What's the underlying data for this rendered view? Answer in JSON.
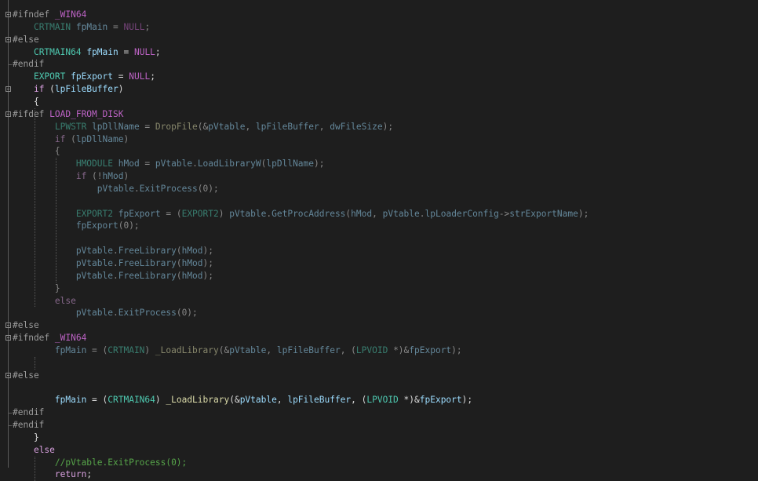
{
  "editor": {
    "lines": [
      {
        "fold": true,
        "dim": false,
        "tokens": [
          [
            "pre",
            "#ifndef "
          ],
          [
            "mac",
            "_WIN64"
          ]
        ]
      },
      {
        "fold": false,
        "dim": true,
        "tokens": [
          [
            "txt",
            "    "
          ],
          [
            "typ",
            "CRTMAIN"
          ],
          [
            "txt",
            " "
          ],
          [
            "id",
            "fpMain"
          ],
          [
            "op",
            " = "
          ],
          [
            "mac",
            "NULL"
          ],
          [
            "op",
            ";"
          ]
        ]
      },
      {
        "fold": true,
        "dim": false,
        "tokens": [
          [
            "pre",
            "#else"
          ]
        ]
      },
      {
        "fold": false,
        "dim": false,
        "tokens": [
          [
            "txt",
            "    "
          ],
          [
            "typ",
            "CRTMAIN64"
          ],
          [
            "txt",
            " "
          ],
          [
            "id",
            "fpMain"
          ],
          [
            "op",
            " = "
          ],
          [
            "mac",
            "NULL"
          ],
          [
            "op",
            ";"
          ]
        ]
      },
      {
        "fold": false,
        "dim": false,
        "tokens": [
          [
            "pre",
            "#endif"
          ]
        ]
      },
      {
        "fold": false,
        "dim": false,
        "tokens": [
          [
            "txt",
            "    "
          ],
          [
            "typ",
            "EXPORT"
          ],
          [
            "txt",
            " "
          ],
          [
            "id",
            "fpExport"
          ],
          [
            "op",
            " = "
          ],
          [
            "mac",
            "NULL"
          ],
          [
            "op",
            ";"
          ]
        ]
      },
      {
        "fold": true,
        "dim": false,
        "tokens": [
          [
            "txt",
            "    "
          ],
          [
            "kw",
            "if"
          ],
          [
            "op",
            " ("
          ],
          [
            "id",
            "lpFileBuffer"
          ],
          [
            "op",
            ")"
          ]
        ]
      },
      {
        "fold": false,
        "dim": false,
        "tokens": [
          [
            "txt",
            "    "
          ],
          [
            "op",
            "{"
          ]
        ]
      },
      {
        "fold": true,
        "dim": false,
        "tokens": [
          [
            "pre",
            "#ifdef "
          ],
          [
            "mac",
            "LOAD_FROM_DISK"
          ]
        ]
      },
      {
        "fold": false,
        "dim": true,
        "tokens": [
          [
            "txt",
            "        "
          ],
          [
            "typ",
            "LPWSTR"
          ],
          [
            "txt",
            " "
          ],
          [
            "id",
            "lpDllName"
          ],
          [
            "op",
            " = "
          ],
          [
            "fn",
            "DropFile"
          ],
          [
            "op",
            "(&"
          ],
          [
            "id",
            "pVtable"
          ],
          [
            "op",
            ", "
          ],
          [
            "id",
            "lpFileBuffer"
          ],
          [
            "op",
            ", "
          ],
          [
            "id",
            "dwFileSize"
          ],
          [
            "op",
            ");"
          ]
        ]
      },
      {
        "fold": false,
        "dim": true,
        "tokens": [
          [
            "txt",
            "        "
          ],
          [
            "kw",
            "if"
          ],
          [
            "op",
            " ("
          ],
          [
            "id",
            "lpDllName"
          ],
          [
            "op",
            ")"
          ]
        ]
      },
      {
        "fold": false,
        "dim": true,
        "tokens": [
          [
            "txt",
            "        "
          ],
          [
            "op",
            "{"
          ]
        ]
      },
      {
        "fold": false,
        "dim": true,
        "tokens": [
          [
            "txt",
            "            "
          ],
          [
            "typ",
            "HMODULE"
          ],
          [
            "txt",
            " "
          ],
          [
            "id",
            "hMod"
          ],
          [
            "op",
            " = "
          ],
          [
            "id",
            "pVtable"
          ],
          [
            "op",
            "."
          ],
          [
            "id",
            "LoadLibraryW"
          ],
          [
            "op",
            "("
          ],
          [
            "id",
            "lpDllName"
          ],
          [
            "op",
            ");"
          ]
        ]
      },
      {
        "fold": false,
        "dim": true,
        "tokens": [
          [
            "txt",
            "            "
          ],
          [
            "kw",
            "if"
          ],
          [
            "op",
            " (!"
          ],
          [
            "id",
            "hMod"
          ],
          [
            "op",
            ")"
          ]
        ]
      },
      {
        "fold": false,
        "dim": true,
        "tokens": [
          [
            "txt",
            "                "
          ],
          [
            "id",
            "pVtable"
          ],
          [
            "op",
            "."
          ],
          [
            "id",
            "ExitProcess"
          ],
          [
            "op",
            "(0);"
          ]
        ]
      },
      {
        "fold": false,
        "dim": true,
        "tokens": []
      },
      {
        "fold": false,
        "dim": true,
        "tokens": [
          [
            "txt",
            "            "
          ],
          [
            "typ",
            "EXPORT2"
          ],
          [
            "txt",
            " "
          ],
          [
            "id",
            "fpExport"
          ],
          [
            "op",
            " = ("
          ],
          [
            "typ",
            "EXPORT2"
          ],
          [
            "op",
            ") "
          ],
          [
            "id",
            "pVtable"
          ],
          [
            "op",
            "."
          ],
          [
            "id",
            "GetProcAddress"
          ],
          [
            "op",
            "("
          ],
          [
            "id",
            "hMod"
          ],
          [
            "op",
            ", "
          ],
          [
            "id",
            "pVtable"
          ],
          [
            "op",
            "."
          ],
          [
            "id",
            "lpLoaderConfig"
          ],
          [
            "op",
            "->"
          ],
          [
            "id",
            "strExportName"
          ],
          [
            "op",
            ");"
          ]
        ]
      },
      {
        "fold": false,
        "dim": true,
        "tokens": [
          [
            "txt",
            "            "
          ],
          [
            "id",
            "fpExport"
          ],
          [
            "op",
            "(0);"
          ]
        ]
      },
      {
        "fold": false,
        "dim": true,
        "tokens": []
      },
      {
        "fold": false,
        "dim": true,
        "tokens": [
          [
            "txt",
            "            "
          ],
          [
            "id",
            "pVtable"
          ],
          [
            "op",
            "."
          ],
          [
            "id",
            "FreeLibrary"
          ],
          [
            "op",
            "("
          ],
          [
            "id",
            "hMod"
          ],
          [
            "op",
            ");"
          ]
        ]
      },
      {
        "fold": false,
        "dim": true,
        "tokens": [
          [
            "txt",
            "            "
          ],
          [
            "id",
            "pVtable"
          ],
          [
            "op",
            "."
          ],
          [
            "id",
            "FreeLibrary"
          ],
          [
            "op",
            "("
          ],
          [
            "id",
            "hMod"
          ],
          [
            "op",
            ");"
          ]
        ]
      },
      {
        "fold": false,
        "dim": true,
        "tokens": [
          [
            "txt",
            "            "
          ],
          [
            "id",
            "pVtable"
          ],
          [
            "op",
            "."
          ],
          [
            "id",
            "FreeLibrary"
          ],
          [
            "op",
            "("
          ],
          [
            "id",
            "hMod"
          ],
          [
            "op",
            ");"
          ]
        ]
      },
      {
        "fold": false,
        "dim": true,
        "tokens": [
          [
            "txt",
            "        "
          ],
          [
            "op",
            "}"
          ]
        ]
      },
      {
        "fold": false,
        "dim": true,
        "tokens": [
          [
            "txt",
            "        "
          ],
          [
            "kw",
            "else"
          ]
        ]
      },
      {
        "fold": false,
        "dim": true,
        "tokens": [
          [
            "txt",
            "            "
          ],
          [
            "id",
            "pVtable"
          ],
          [
            "op",
            "."
          ],
          [
            "id",
            "ExitProcess"
          ],
          [
            "op",
            "(0);"
          ]
        ]
      },
      {
        "fold": true,
        "dim": false,
        "tokens": [
          [
            "pre",
            "#else"
          ]
        ]
      },
      {
        "fold": true,
        "dim": false,
        "tokens": [
          [
            "pre",
            "#ifndef "
          ],
          [
            "mac",
            "_WIN64"
          ]
        ]
      },
      {
        "fold": false,
        "dim": true,
        "tokens": [
          [
            "txt",
            "        "
          ],
          [
            "id",
            "fpMain"
          ],
          [
            "op",
            " = ("
          ],
          [
            "typ",
            "CRTMAIN"
          ],
          [
            "op",
            ") "
          ],
          [
            "fn",
            "_LoadLibrary"
          ],
          [
            "op",
            "(&"
          ],
          [
            "id",
            "pVtable"
          ],
          [
            "op",
            ", "
          ],
          [
            "id",
            "lpFileBuffer"
          ],
          [
            "op",
            ", ("
          ],
          [
            "typ",
            "LPVOID"
          ],
          [
            "op",
            " *)&"
          ],
          [
            "id",
            "fpExport"
          ],
          [
            "op",
            ");"
          ]
        ]
      },
      {
        "fold": false,
        "dim": true,
        "tokens": []
      },
      {
        "fold": true,
        "dim": false,
        "tokens": [
          [
            "pre",
            "#else"
          ]
        ]
      },
      {
        "fold": false,
        "dim": false,
        "tokens": []
      },
      {
        "fold": false,
        "dim": false,
        "tokens": [
          [
            "txt",
            "        "
          ],
          [
            "id",
            "fpMain"
          ],
          [
            "op",
            " = ("
          ],
          [
            "typ",
            "CRTMAIN64"
          ],
          [
            "op",
            ") "
          ],
          [
            "fn",
            "_LoadLibrary"
          ],
          [
            "op",
            "(&"
          ],
          [
            "id",
            "pVtable"
          ],
          [
            "op",
            ", "
          ],
          [
            "id",
            "lpFileBuffer"
          ],
          [
            "op",
            ", ("
          ],
          [
            "typ",
            "LPVOID"
          ],
          [
            "op",
            " *)&"
          ],
          [
            "id",
            "fpExport"
          ],
          [
            "op",
            ");"
          ]
        ]
      },
      {
        "fold": false,
        "dim": false,
        "tokens": [
          [
            "pre",
            "#endif"
          ]
        ]
      },
      {
        "fold": false,
        "dim": false,
        "tokens": [
          [
            "pre",
            "#endif"
          ]
        ]
      },
      {
        "fold": false,
        "dim": false,
        "tokens": [
          [
            "txt",
            "    "
          ],
          [
            "op",
            "}"
          ]
        ]
      },
      {
        "fold": false,
        "dim": false,
        "tokens": [
          [
            "txt",
            "    "
          ],
          [
            "kw",
            "else"
          ]
        ]
      },
      {
        "fold": false,
        "dim": false,
        "tokens": [
          [
            "txt",
            "        "
          ],
          [
            "cmt",
            "//pVtable.ExitProcess(0);"
          ]
        ]
      },
      {
        "fold": false,
        "dim": false,
        "tokens": [
          [
            "txt",
            "        "
          ],
          [
            "kw",
            "return"
          ],
          [
            "op",
            ";"
          ]
        ]
      }
    ]
  },
  "colors": {
    "background": "#1e1e1e",
    "preprocessor": "#9b9b9b",
    "macro": "#bd63c5",
    "type": "#4ec9b0",
    "keyword": "#d8a0df",
    "identifier": "#9cdcfe",
    "function": "#dcdcaa",
    "comment": "#57a64a"
  }
}
